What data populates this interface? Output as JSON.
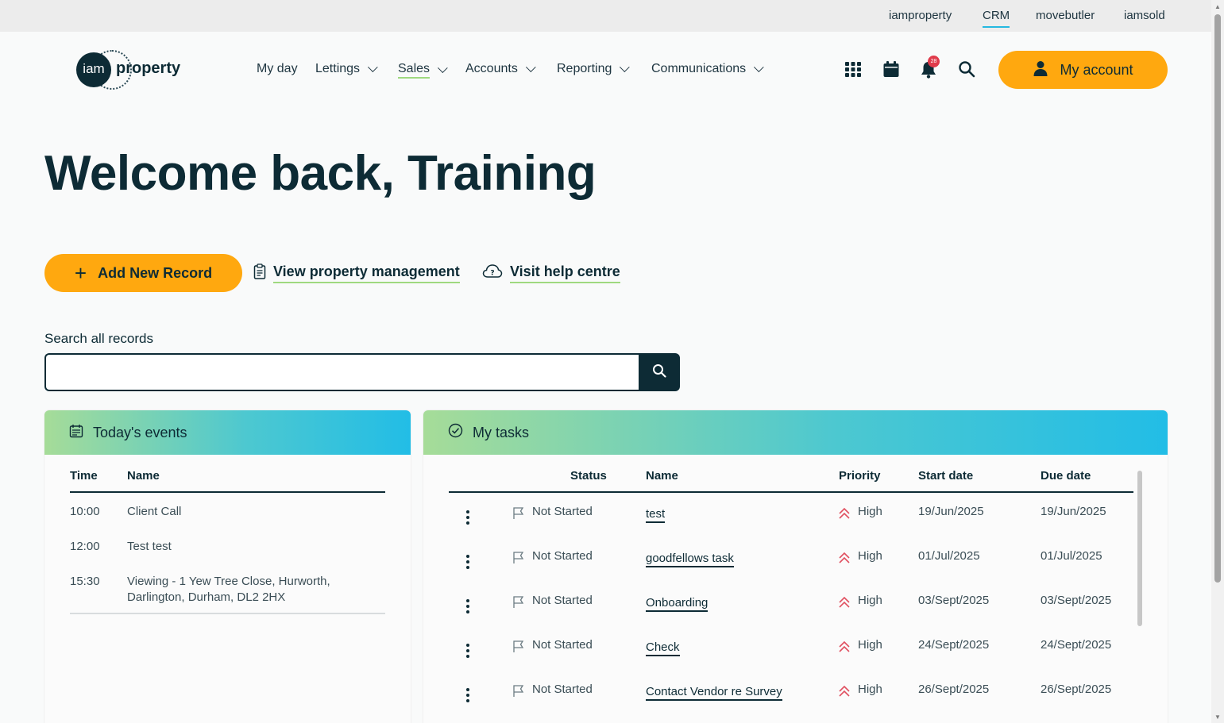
{
  "topbar": {
    "links": [
      {
        "label": "iamproperty",
        "active": false
      },
      {
        "label": "CRM",
        "active": true
      },
      {
        "label": "movebutler",
        "active": false
      },
      {
        "label": "iamsold",
        "active": false
      }
    ]
  },
  "header": {
    "logo": {
      "mark": "iam",
      "word": "property"
    },
    "nav": [
      {
        "label": "My day",
        "dropdown": false,
        "active": false
      },
      {
        "label": "Lettings",
        "dropdown": true,
        "active": false
      },
      {
        "label": "Sales",
        "dropdown": true,
        "active": true
      },
      {
        "label": "Accounts",
        "dropdown": true,
        "active": false
      },
      {
        "label": "Reporting",
        "dropdown": true,
        "active": false
      },
      {
        "label": "Communications",
        "dropdown": true,
        "active": false
      }
    ],
    "notification_count": "28",
    "account_label": "My account",
    "icons": [
      "apps-grid-icon",
      "calendar-icon",
      "bell-icon",
      "search-icon",
      "user-icon"
    ]
  },
  "welcome": {
    "title": "Welcome back, Training"
  },
  "actions": {
    "add_record": "Add New Record",
    "view_property": "View property management",
    "help_centre": "Visit help centre"
  },
  "search": {
    "label": "Search all records",
    "value": "",
    "placeholder": ""
  },
  "events": {
    "title": "Today's events",
    "columns": [
      "Time",
      "Name"
    ],
    "rows": [
      {
        "time": "10:00",
        "name": "Client Call"
      },
      {
        "time": "12:00",
        "name": "Test test"
      },
      {
        "time": "15:30",
        "name": "Viewing - 1 Yew Tree Close, Hurworth, Darlington, Durham, DL2 2HX"
      }
    ]
  },
  "tasks": {
    "title": "My tasks",
    "columns": [
      "Status",
      "Name",
      "Priority",
      "Start date",
      "Due date"
    ],
    "rows": [
      {
        "status": "Not Started",
        "name": "test",
        "priority": "High",
        "start": "19/Jun/2025",
        "due": "19/Jun/2025"
      },
      {
        "status": "Not Started",
        "name": "goodfellows task",
        "priority": "High",
        "start": "01/Jul/2025",
        "due": "01/Jul/2025"
      },
      {
        "status": "Not Started",
        "name": "Onboarding",
        "priority": "High",
        "start": "03/Sept/2025",
        "due": "03/Sept/2025"
      },
      {
        "status": "Not Started",
        "name": "Check",
        "priority": "High",
        "start": "24/Sept/2025",
        "due": "24/Sept/2025"
      },
      {
        "status": "Not Started",
        "name": "Contact Vendor re Survey",
        "priority": "High",
        "start": "26/Sept/2025",
        "due": "26/Sept/2025"
      }
    ]
  },
  "colors": {
    "accent": "#ffa80f",
    "dark": "#0d2b35",
    "underline": "#9fd97f",
    "priority_high": "#e05060",
    "badge": "#e03b4b"
  }
}
